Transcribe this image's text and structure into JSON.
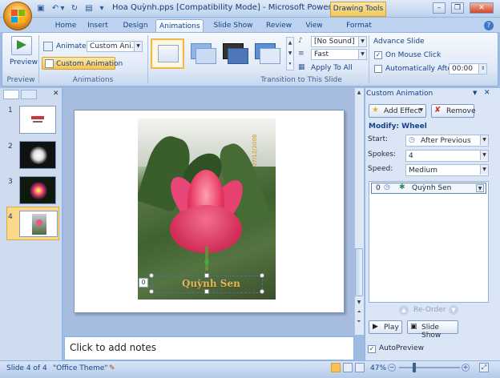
{
  "title": "Hoa Quỳnh.pps [Compatibility Mode] - Microsoft PowerPoint n...",
  "context_tab": "Drawing Tools",
  "tabs": [
    "Home",
    "Insert",
    "Design",
    "Animations",
    "Slide Show",
    "Review",
    "View",
    "Format"
  ],
  "ribbon": {
    "preview_label": "Preview",
    "preview_group": "Preview",
    "animate_label": "Animate:",
    "animate_value": "Custom Ani...",
    "custom_animation": "Custom Animation",
    "animations_group": "Animations",
    "sound_value": "[No Sound]",
    "speed_value": "Fast",
    "apply_all": "Apply To All",
    "transition_group": "Transition to This Slide",
    "advance_title": "Advance Slide",
    "on_mouse_click": "On Mouse Click",
    "auto_after": "Automatically After:",
    "auto_time": "00:00"
  },
  "slides": [
    {
      "num": "1"
    },
    {
      "num": "2"
    },
    {
      "num": "3"
    },
    {
      "num": "4"
    }
  ],
  "slide": {
    "caption": "Quỳnh Sen",
    "date_text": "07/12/2008",
    "order_tag": "0"
  },
  "notes_placeholder": "Click to add notes",
  "taskpane": {
    "title": "Custom Animation",
    "add_effect": "Add Effect",
    "remove": "Remove",
    "modify": "Modify: Wheel",
    "start_label": "Start:",
    "start_value": "After Previous",
    "spokes_label": "Spokes:",
    "spokes_value": "4",
    "speed_label": "Speed:",
    "speed_value": "Medium",
    "list_item": {
      "order": "0",
      "name": "Quỳnh Sen"
    },
    "reorder": "Re-Order",
    "play": "Play",
    "slide_show": "Slide Show",
    "autopreview": "AutoPreview"
  },
  "status": {
    "slide": "Slide 4 of 4",
    "theme": "\"Office Theme\"",
    "zoom": "47%"
  }
}
